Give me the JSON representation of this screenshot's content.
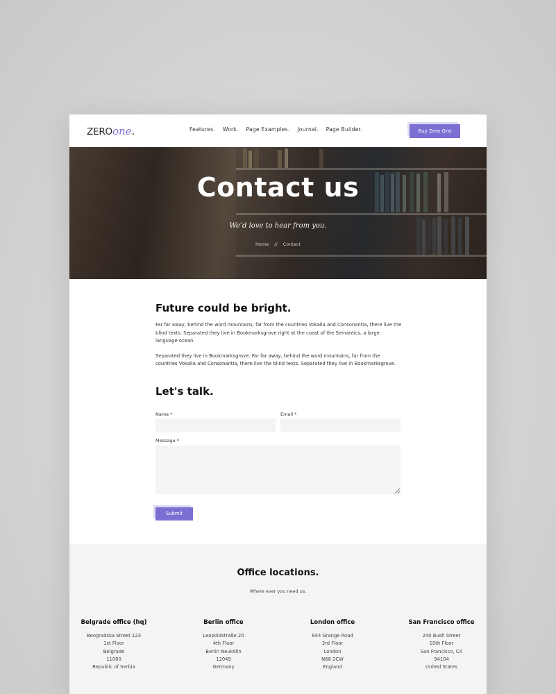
{
  "header": {
    "logo_part1": "ZERO",
    "logo_part2": "one",
    "logo_dot": ".",
    "nav": [
      "Features.",
      "Work.",
      "Page Examples.",
      "Journal.",
      "Page Builder."
    ],
    "buy_label": "Buy Zero One"
  },
  "hero": {
    "title": "Contact us",
    "subtitle": "We’d love to hear from you.",
    "breadcrumb_home": "Home",
    "breadcrumb_sep": "//",
    "breadcrumb_current": "Contact"
  },
  "intro": {
    "heading": "Future could be bright.",
    "para1": "Far far away, behind the word mountains, far from the countries Vokalia and Consonantia, there live the blind texts. Separated they live in Bookmarksgrove right at the coast of the Semantics, a large language ocean.",
    "para2": "Separated they live in Bookmarksgrove. Far far away, behind the word mountains, far from the countries Vokalia and Consonantia, there live the blind texts. Separated they live in Bookmarksgrove."
  },
  "form": {
    "heading": "Let's talk.",
    "name_label": "Name *",
    "email_label": "Email *",
    "message_label": "Message *",
    "name_value": "",
    "email_value": "",
    "message_value": "",
    "submit_label": "Submit"
  },
  "offices": {
    "title": "Office locations.",
    "subtitle": "Where ever you need us.",
    "items": [
      {
        "name": "Belgrade office (hq)",
        "lines": [
          "Beogradska Street 123",
          "1st Floor",
          "Belgrade",
          "11000",
          "Republic of Serbia"
        ]
      },
      {
        "name": "Berlin office",
        "lines": [
          "Leopoldstraße 20",
          "4th Floor",
          "Berlin Neukölln",
          "12049",
          "Germany"
        ]
      },
      {
        "name": "London office",
        "lines": [
          "844 Grange Road",
          "3rd Floor",
          "London",
          "N68 2CW",
          "England"
        ]
      },
      {
        "name": "San Francisco office",
        "lines": [
          "240 Bush Street",
          "10th Floor",
          "San Francisco, CA",
          "94104",
          "United States"
        ]
      }
    ]
  },
  "colors": {
    "accent": "#7b6fd3",
    "section_bg": "#f4f4f4",
    "backdrop": "#d4d4d4"
  }
}
